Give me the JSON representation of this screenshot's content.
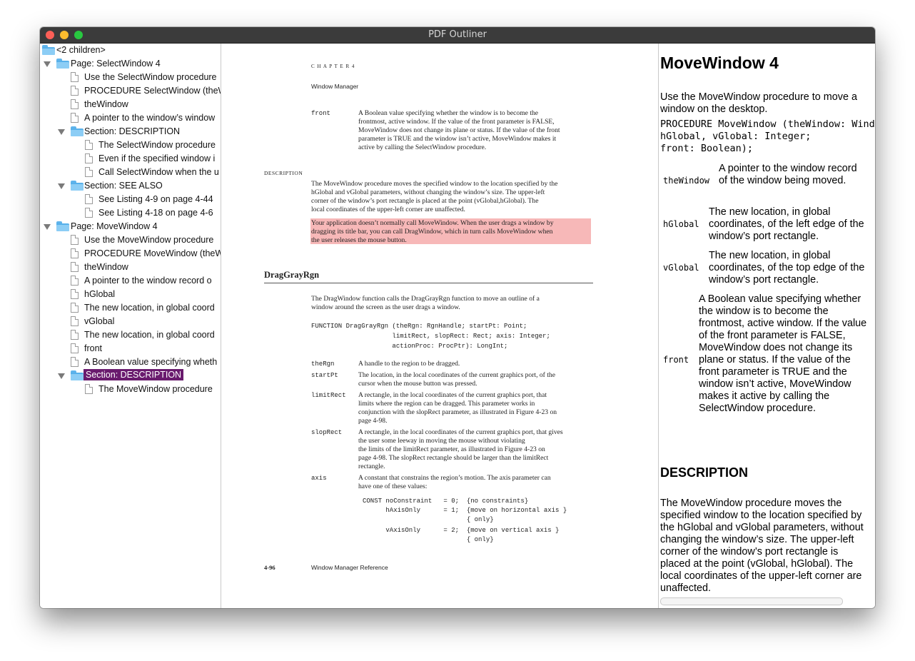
{
  "window": {
    "title": "PDF Outliner"
  },
  "outline": {
    "items": [
      {
        "label": "<2 children>",
        "kind": "folder",
        "expanded": false
      },
      {
        "label": "Page: SelectWindow 4",
        "kind": "folder",
        "expanded": true
      },
      {
        "label": "Use the SelectWindow procedure",
        "kind": "doc"
      },
      {
        "label": "PROCEDURE SelectWindow (theWi",
        "kind": "doc"
      },
      {
        "label": "theWindow",
        "kind": "doc"
      },
      {
        "label": "A pointer to the window’s window",
        "kind": "doc"
      },
      {
        "label": "Section: DESCRIPTION",
        "kind": "folder",
        "expanded": true
      },
      {
        "label": "The SelectWindow procedure",
        "kind": "doc"
      },
      {
        "label": "Even if the specified window i",
        "kind": "doc"
      },
      {
        "label": "Call SelectWindow when the u",
        "kind": "doc"
      },
      {
        "label": "Section: SEE ALSO",
        "kind": "folder",
        "expanded": true
      },
      {
        "label": "See Listing 4-9 on page 4-44",
        "kind": "doc"
      },
      {
        "label": "See Listing 4-18 on page 4-6",
        "kind": "doc"
      },
      {
        "label": "Page: MoveWindow 4",
        "kind": "folder",
        "expanded": true
      },
      {
        "label": "Use the MoveWindow procedure",
        "kind": "doc"
      },
      {
        "label": "PROCEDURE MoveWindow (theWi",
        "kind": "doc"
      },
      {
        "label": "theWindow",
        "kind": "doc"
      },
      {
        "label": "A pointer to the window record o",
        "kind": "doc"
      },
      {
        "label": "hGlobal",
        "kind": "doc"
      },
      {
        "label": "The new location, in global coord",
        "kind": "doc"
      },
      {
        "label": "vGlobal",
        "kind": "doc"
      },
      {
        "label": "The new location, in global coord",
        "kind": "doc"
      },
      {
        "label": "front",
        "kind": "doc"
      },
      {
        "label": "A Boolean value specifying wheth",
        "kind": "doc"
      },
      {
        "label": "Section: DESCRIPTION",
        "kind": "folder",
        "expanded": true,
        "selected": true
      },
      {
        "label": "The MoveWindow procedure",
        "kind": "doc"
      }
    ]
  },
  "pdf": {
    "chapter": "C H A P T E R   4",
    "chapter_title": "Window Manager",
    "front_param": "front",
    "front_lines": [
      "A Boolean value specifying whether the window is to become the",
      "frontmost, active window. If the value of the front parameter is FALSE,",
      "MoveWindow does not change its plane or status. If the value of the front",
      "parameter is TRUE and the window isn’t active, MoveWindow makes it",
      "active by calling the SelectWindow procedure."
    ],
    "desc_heading": "DESCRIPTION",
    "desc_lines": [
      "The MoveWindow procedure moves the specified window to the location specified by the",
      "hGlobal and vGlobal parameters, without changing the window’s size. The upper-left",
      "corner of the window’s port rectangle is placed at the point (vGlobal,hGlobal). The",
      "local coordinates of the upper-left corner are unaffected."
    ],
    "highlight_lines": [
      "Your application doesn’t normally call MoveWindow. When the user drags a window by",
      "dragging its title bar, you can call DragWindow, which in turn calls MoveWindow when",
      "the user releases the mouse button."
    ],
    "section_title": "DragGrayRgn",
    "intro_lines": [
      "The DragWindow function calls the DragGrayRgn function to move an outline of a",
      "window around the screen as the user drags a window."
    ],
    "code_lines": [
      "FUNCTION DragGrayRgn (theRgn: RgnHandle; startPt: Point;",
      "                     limitRect, slopRect: Rect; axis: Integer;",
      "                     actionProc: ProcPtr): LongInt;"
    ],
    "params": [
      {
        "name": "theRgn",
        "lines": [
          "A handle to the region to be dragged."
        ]
      },
      {
        "name": "startPt",
        "lines": [
          "The location, in the local coordinates of the current graphics port, of the",
          "cursor when the mouse button was pressed."
        ]
      },
      {
        "name": "limitRect",
        "lines": [
          "A rectangle, in the local coordinates of the current graphics port, that",
          "limits where the region can be dragged. This parameter works in",
          "conjunction with the slopRect parameter, as illustrated in Figure 4-23 on",
          "page 4-98."
        ]
      },
      {
        "name": "slopRect",
        "lines": [
          "A rectangle, in the local coordinates of the current graphics port, that gives",
          "the user some leeway in moving the mouse without violating",
          "the limits of the limitRect parameter, as illustrated in Figure 4-23 on",
          "page 4-98. The slopRect rectangle should be larger than the limitRect",
          "rectangle."
        ]
      },
      {
        "name": "axis",
        "lines": [
          "A constant that constrains the region’s motion. The axis parameter can",
          "have one of these values:"
        ]
      }
    ],
    "const_lines": [
      "CONST noConstraint   = 0;  {no constraints}",
      "      hAxisOnly      = 1;  {move on horizontal axis }",
      "                           { only}",
      "      vAxisOnly      = 2;  {move on vertical axis }",
      "                           { only}"
    ],
    "footer_page": "4-96",
    "footer_title": "Window Manager Reference"
  },
  "text": {
    "heading": "MoveWindow 4",
    "intro": "Use the MoveWindow procedure to move a window on the desktop.",
    "proc_lines": [
      "PROCEDURE MoveWindow (theWindow: Windo",
      "hGlobal, vGlobal: Integer;",
      "front: Boolean);"
    ],
    "params": [
      {
        "name": "theWindow",
        "desc": "A pointer to the window record of the window being moved."
      },
      {
        "name": "hGlobal",
        "desc": "The new location, in global coordinates, of the left edge of the window’s port rectangle."
      },
      {
        "name": "vGlobal",
        "desc": "The new location, in global coordinates, of the top edge of the window’s port rectangle."
      },
      {
        "name": "front",
        "desc": "A Boolean value specifying whether the window is to become the frontmost, active window. If the value of the front parameter is FALSE, MoveWindow does not change its plane or status. If the value of the front parameter is TRUE and the window isn’t active, MoveWindow makes it active by calling the SelectWindow procedure."
      }
    ],
    "desc_heading": "DESCRIPTION",
    "desc": "The MoveWindow procedure moves the specified window to the location specified by the hGlobal and vGlobal parameters, without changing the window’s size. The upper-left corner of the window’s port rectangle is placed at the point (vGlobal, hGlobal). The local coordinates of the upper-left corner are unaffected."
  }
}
